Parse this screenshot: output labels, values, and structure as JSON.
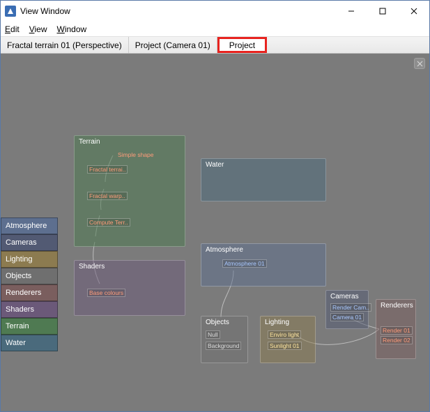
{
  "window": {
    "title": "View Window"
  },
  "menubar": [
    "Edit",
    "View",
    "Window"
  ],
  "tabs": [
    "Fractal terrain 01 (Perspective)",
    "Project (Camera 01)",
    "Project"
  ],
  "categories": [
    {
      "label": "Atmosphere",
      "color": "#5d6f8f"
    },
    {
      "label": "Cameras",
      "color": "#525a73"
    },
    {
      "label": "Lighting",
      "color": "#8c7b50"
    },
    {
      "label": "Objects",
      "color": "#6f6f6f"
    },
    {
      "label": "Renderers",
      "color": "#7a5e5e"
    },
    {
      "label": "Shaders",
      "color": "#6b5979"
    },
    {
      "label": "Terrain",
      "color": "#4f7a52"
    },
    {
      "label": "Water",
      "color": "#4a6a7c"
    }
  ],
  "panels": {
    "terrain": {
      "label": "Terrain",
      "color": "rgba(79,122,82,.55)"
    },
    "shaders": {
      "label": "Shaders",
      "color": "rgba(107,89,121,.5)"
    },
    "water": {
      "label": "Water",
      "color": "rgba(74,106,124,.5)"
    },
    "atmosphere": {
      "label": "Atmosphere",
      "color": "rgba(93,111,143,.5)"
    },
    "objects": {
      "label": "Objects",
      "color": "rgba(111,111,111,.5)"
    },
    "lighting": {
      "label": "Lighting",
      "color": "rgba(140,123,80,.5)"
    },
    "cameras": {
      "label": "Cameras",
      "color": "rgba(82,90,115,.5)"
    },
    "renderers": {
      "label": "Renderers",
      "color": "rgba(122,94,94,.5)"
    }
  },
  "nodes": {
    "simple_shape": "Simple shape",
    "fractal_terrain": "Fractal terrai..",
    "fractal_warp": "Fractal warp..",
    "compute_terr": "Compute Terr..",
    "base_colours": "Base colours",
    "atmosphere01": "Atmosphere 01",
    "null_obj": "Null",
    "background": "Background",
    "enviro_light": "Enviro light",
    "sunlight01": "Sunlight 01",
    "render_cam": "Render Cam..",
    "camera01": "Camera 01",
    "render01": "Render 01",
    "render02": "Render 02"
  }
}
